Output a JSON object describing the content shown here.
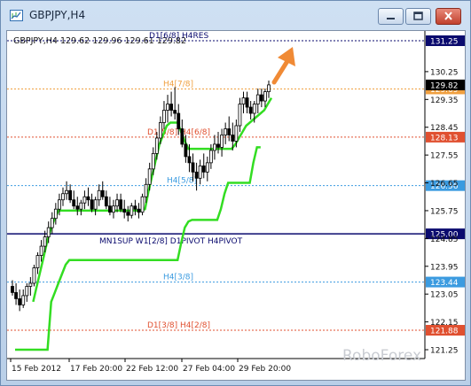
{
  "window": {
    "title": "GBPJPY,H4",
    "buttons": [
      "minimize",
      "maximize",
      "close"
    ]
  },
  "chart_data": {
    "type": "candlestick",
    "symbol_line": "GBPJPY,H4  129.62 129.96 129.61 129.82",
    "y_ticks": [
      "130.25",
      "129.35",
      "128.45",
      "127.55",
      "126.65",
      "125.75",
      "124.85",
      "123.95",
      "123.05",
      "122.15",
      "121.25"
    ],
    "x_ticks": [
      "15 Feb 2012",
      "17 Feb 20:00",
      "22 Feb 12:00",
      "27 Feb 04:00",
      "29 Feb 20:00"
    ],
    "ylim": [
      120.95,
      131.55
    ],
    "levels": [
      {
        "label": "D1[6/8] H4RES",
        "value": 131.25,
        "price_label": "131.25",
        "color": "#0a0a6e",
        "style": "dotted"
      },
      {
        "label": "H4[7/8]",
        "value": 129.69,
        "price_label": "129.69",
        "color": "#f0a040",
        "style": "dotted"
      },
      {
        "label": "D1[5/8] H4[6/8]",
        "value": 128.13,
        "price_label": "128.13",
        "color": "#e05030",
        "style": "dotted"
      },
      {
        "label": "H4[5/8]",
        "value": 126.56,
        "price_label": "126.56",
        "color": "#3b9be0",
        "style": "dotted"
      },
      {
        "label": "MN1SUP W1[2/8] D1PIVOT H4PIVOT",
        "value": 125.0,
        "price_label": "125.00",
        "color": "#0a0a6e",
        "style": "solid"
      },
      {
        "label": "H4[3/8]",
        "value": 123.44,
        "price_label": "123.44",
        "color": "#3b9be0",
        "style": "dotted"
      },
      {
        "label": "D1[3/8] H4[2/8]",
        "value": 121.88,
        "price_label": "121.88",
        "color": "#e05030",
        "style": "dotted"
      }
    ],
    "current_price": "129.82",
    "watermark": "RoboForex",
    "candles": [
      [
        123.3,
        123.5,
        123.0,
        123.1
      ],
      [
        123.1,
        123.4,
        122.7,
        122.9
      ],
      [
        122.9,
        123.2,
        122.5,
        122.7
      ],
      [
        122.7,
        123.2,
        122.6,
        123.0
      ],
      [
        123.0,
        123.4,
        122.8,
        123.3
      ],
      [
        123.3,
        123.6,
        123.0,
        123.4
      ],
      [
        123.4,
        124.0,
        123.3,
        123.9
      ],
      [
        123.9,
        124.4,
        123.7,
        124.3
      ],
      [
        124.3,
        124.8,
        124.1,
        124.6
      ],
      [
        124.6,
        125.1,
        124.4,
        124.9
      ],
      [
        124.9,
        125.4,
        124.7,
        125.2
      ],
      [
        125.2,
        125.7,
        125.0,
        125.5
      ],
      [
        125.5,
        126.0,
        125.3,
        125.8
      ],
      [
        125.8,
        126.3,
        125.6,
        126.1
      ],
      [
        126.1,
        126.5,
        125.9,
        126.3
      ],
      [
        126.3,
        126.7,
        126.1,
        126.4
      ],
      [
        126.4,
        126.6,
        126.0,
        126.1
      ],
      [
        126.1,
        126.4,
        125.8,
        125.9
      ],
      [
        125.9,
        126.2,
        125.6,
        125.8
      ],
      [
        125.8,
        126.1,
        125.6,
        126.0
      ],
      [
        126.0,
        126.4,
        125.8,
        126.2
      ],
      [
        126.2,
        126.5,
        125.9,
        126.1
      ],
      [
        126.1,
        126.3,
        125.7,
        125.8
      ],
      [
        125.8,
        126.2,
        125.6,
        126.1
      ],
      [
        126.1,
        126.6,
        125.9,
        126.4
      ],
      [
        126.4,
        126.7,
        126.1,
        126.2
      ],
      [
        126.2,
        126.4,
        125.8,
        125.9
      ],
      [
        125.9,
        126.2,
        125.6,
        125.7
      ],
      [
        125.7,
        126.1,
        125.5,
        125.9
      ],
      [
        125.9,
        126.3,
        125.7,
        126.1
      ],
      [
        126.1,
        126.3,
        125.7,
        125.8
      ],
      [
        125.8,
        126.1,
        125.5,
        125.7
      ],
      [
        125.7,
        125.9,
        125.4,
        125.6
      ],
      [
        125.6,
        126.0,
        125.5,
        125.9
      ],
      [
        125.9,
        126.1,
        125.6,
        125.8
      ],
      [
        125.8,
        126.0,
        125.5,
        125.7
      ],
      [
        125.7,
        126.3,
        125.6,
        126.2
      ],
      [
        126.2,
        126.8,
        126.0,
        126.6
      ],
      [
        126.6,
        127.3,
        126.4,
        127.1
      ],
      [
        127.1,
        127.8,
        126.9,
        127.6
      ],
      [
        127.6,
        128.3,
        127.4,
        128.1
      ],
      [
        128.1,
        128.8,
        127.9,
        128.6
      ],
      [
        128.6,
        129.3,
        128.4,
        129.0
      ],
      [
        129.0,
        129.5,
        128.6,
        129.2
      ],
      [
        129.2,
        129.6,
        128.8,
        129.0
      ],
      [
        129.0,
        129.75,
        128.7,
        128.9
      ],
      [
        128.9,
        129.2,
        128.2,
        128.4
      ],
      [
        128.4,
        128.7,
        127.8,
        127.9
      ],
      [
        127.9,
        128.2,
        127.3,
        127.5
      ],
      [
        127.5,
        127.9,
        127.0,
        127.3
      ],
      [
        127.3,
        127.6,
        126.7,
        127.0
      ],
      [
        127.0,
        127.3,
        126.4,
        126.8
      ],
      [
        126.8,
        127.4,
        126.6,
        127.2
      ],
      [
        127.2,
        127.6,
        126.8,
        127.0
      ],
      [
        127.0,
        127.5,
        126.7,
        127.3
      ],
      [
        127.3,
        127.9,
        127.1,
        127.7
      ],
      [
        127.7,
        128.2,
        127.4,
        127.9
      ],
      [
        127.9,
        128.3,
        127.6,
        127.8
      ],
      [
        127.8,
        128.4,
        127.5,
        128.2
      ],
      [
        128.2,
        128.6,
        127.9,
        128.4
      ],
      [
        128.4,
        128.8,
        128.0,
        128.2
      ],
      [
        128.2,
        128.6,
        127.7,
        128.0
      ],
      [
        128.0,
        128.7,
        127.8,
        128.5
      ],
      [
        128.5,
        129.4,
        128.3,
        129.2
      ],
      [
        129.2,
        129.6,
        128.9,
        129.4
      ],
      [
        129.4,
        129.6,
        128.9,
        129.1
      ],
      [
        129.1,
        129.3,
        128.7,
        128.9
      ],
      [
        128.9,
        129.3,
        128.6,
        129.2
      ],
      [
        129.2,
        129.7,
        128.9,
        129.5
      ],
      [
        129.5,
        129.7,
        129.1,
        129.3
      ],
      [
        129.3,
        129.7,
        129.1,
        129.6
      ],
      [
        129.6,
        129.96,
        129.4,
        129.82
      ]
    ],
    "upper_band": [
      null,
      null,
      null,
      null,
      null,
      122.8,
      123.3,
      123.8,
      124.3,
      124.8,
      125.2,
      125.5,
      125.75,
      125.75,
      125.75,
      125.75,
      125.75,
      125.75,
      125.75,
      125.75,
      125.75,
      125.75,
      125.75,
      125.75,
      125.75,
      125.75,
      125.75,
      125.75,
      125.75,
      125.75,
      125.75,
      125.75,
      125.75,
      125.75,
      125.75,
      125.75,
      125.8,
      126.4,
      126.9,
      127.4,
      127.9,
      128.2,
      128.5,
      128.6,
      128.6,
      128.6,
      128.3,
      128.0,
      127.75,
      127.75,
      127.75,
      127.75,
      127.75,
      127.75,
      127.75,
      127.75,
      127.75,
      127.75,
      127.75,
      127.75,
      127.75,
      127.9,
      128.1,
      128.3,
      128.5,
      128.6,
      128.7,
      128.8,
      128.9,
      129.0,
      129.2,
      129.4
    ],
    "lower_band": [
      121.25,
      121.25,
      121.25,
      121.25,
      121.25,
      121.25,
      121.25,
      121.25,
      121.25,
      121.25,
      122.8,
      123.1,
      123.4,
      123.7,
      124.0,
      124.15,
      124.15,
      124.15,
      124.15,
      124.15,
      124.15,
      124.15,
      124.15,
      124.15,
      124.15,
      124.15,
      124.15,
      124.15,
      124.15,
      124.15,
      124.15,
      124.15,
      124.15,
      124.15,
      124.15,
      124.15,
      124.15,
      124.15,
      124.15,
      124.15,
      124.15,
      124.15,
      124.15,
      124.15,
      124.15,
      124.15,
      124.7,
      125.2,
      125.4,
      125.45,
      125.45,
      125.45,
      125.45,
      125.45,
      125.45,
      125.45,
      125.45,
      125.8,
      126.3,
      126.65,
      126.65,
      126.65,
      126.65,
      126.65,
      126.65,
      126.65,
      127.3,
      127.8,
      127.8
    ]
  }
}
